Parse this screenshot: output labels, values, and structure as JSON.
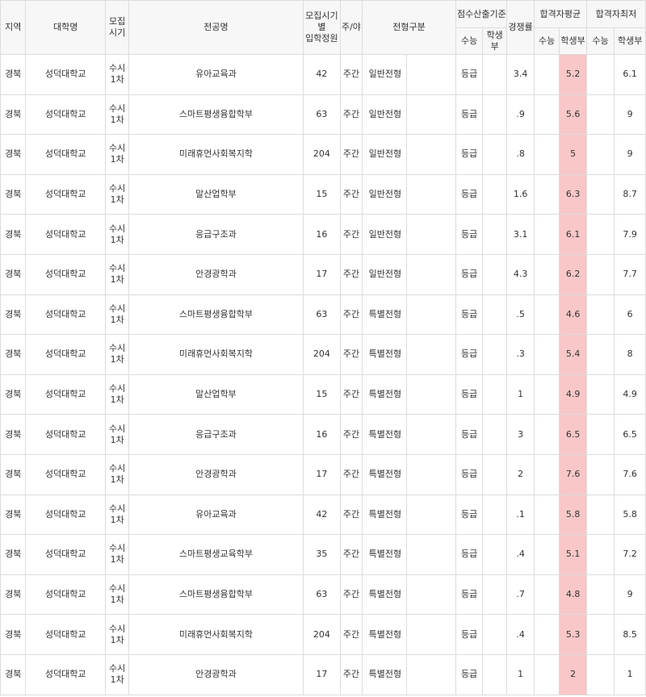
{
  "headers": {
    "region": "지역",
    "university": "대학명",
    "period": "모집\n시기",
    "major": "전공명",
    "quota": "모집시기별\n입학정원",
    "daynight": "주/야",
    "admission_type": "전형구분",
    "score_basis": "점수산출기준",
    "competition": "경쟁률",
    "avg": "합격자평균",
    "min": "합격자최저",
    "suneung": "수능",
    "school_record": "학생부"
  },
  "accent_color": "#f9c7c8",
  "rows": [
    {
      "region": "경북",
      "university": "성덕대학교",
      "period": "수시\n1차",
      "major": "유아교육과",
      "quota": "42",
      "daynight": "주간",
      "admission": "일반전형",
      "basis_suneung": "등급",
      "basis_record": "",
      "competition": "3.4",
      "avg_suneung": "",
      "avg_record": "5.2",
      "min_suneung": "",
      "min_record": "6.1"
    },
    {
      "region": "경북",
      "university": "성덕대학교",
      "period": "수시\n1차",
      "major": "스마트평생융합학부",
      "quota": "63",
      "daynight": "주간",
      "admission": "일반전형",
      "basis_suneung": "등급",
      "basis_record": "",
      "competition": ".9",
      "avg_suneung": "",
      "avg_record": "5.6",
      "min_suneung": "",
      "min_record": "9"
    },
    {
      "region": "경북",
      "university": "성덕대학교",
      "period": "수시\n1차",
      "major": "미래휴먼사회복지학",
      "quota": "204",
      "daynight": "주간",
      "admission": "일반전형",
      "basis_suneung": "등급",
      "basis_record": "",
      "competition": ".8",
      "avg_suneung": "",
      "avg_record": "5",
      "min_suneung": "",
      "min_record": "9"
    },
    {
      "region": "경북",
      "university": "성덕대학교",
      "period": "수시\n1차",
      "major": "말산업학부",
      "quota": "15",
      "daynight": "주간",
      "admission": "일반전형",
      "basis_suneung": "등급",
      "basis_record": "",
      "competition": "1.6",
      "avg_suneung": "",
      "avg_record": "6.3",
      "min_suneung": "",
      "min_record": "8.7"
    },
    {
      "region": "경북",
      "university": "성덕대학교",
      "period": "수시\n1차",
      "major": "응급구조과",
      "quota": "16",
      "daynight": "주간",
      "admission": "일반전형",
      "basis_suneung": "등급",
      "basis_record": "",
      "competition": "3.1",
      "avg_suneung": "",
      "avg_record": "6.1",
      "min_suneung": "",
      "min_record": "7.9"
    },
    {
      "region": "경북",
      "university": "성덕대학교",
      "period": "수시\n1차",
      "major": "안경광학과",
      "quota": "17",
      "daynight": "주간",
      "admission": "일반전형",
      "basis_suneung": "등급",
      "basis_record": "",
      "competition": "4.3",
      "avg_suneung": "",
      "avg_record": "6.2",
      "min_suneung": "",
      "min_record": "7.7"
    },
    {
      "region": "경북",
      "university": "성덕대학교",
      "period": "수시\n1차",
      "major": "스마트평생융합학부",
      "quota": "63",
      "daynight": "주간",
      "admission": "특별전형",
      "basis_suneung": "등급",
      "basis_record": "",
      "competition": ".5",
      "avg_suneung": "",
      "avg_record": "4.6",
      "min_suneung": "",
      "min_record": "6"
    },
    {
      "region": "경북",
      "university": "성덕대학교",
      "period": "수시\n1차",
      "major": "미래휴먼사회복지학",
      "quota": "204",
      "daynight": "주간",
      "admission": "특별전형",
      "basis_suneung": "등급",
      "basis_record": "",
      "competition": ".3",
      "avg_suneung": "",
      "avg_record": "5.4",
      "min_suneung": "",
      "min_record": "8"
    },
    {
      "region": "경북",
      "university": "성덕대학교",
      "period": "수시\n1차",
      "major": "말산업학부",
      "quota": "15",
      "daynight": "주간",
      "admission": "특별전형",
      "basis_suneung": "등급",
      "basis_record": "",
      "competition": "1",
      "avg_suneung": "",
      "avg_record": "4.9",
      "min_suneung": "",
      "min_record": "4.9"
    },
    {
      "region": "경북",
      "university": "성덕대학교",
      "period": "수시\n1차",
      "major": "응급구조과",
      "quota": "16",
      "daynight": "주간",
      "admission": "특별전형",
      "basis_suneung": "등급",
      "basis_record": "",
      "competition": "3",
      "avg_suneung": "",
      "avg_record": "6.5",
      "min_suneung": "",
      "min_record": "6.5"
    },
    {
      "region": "경북",
      "university": "성덕대학교",
      "period": "수시\n1차",
      "major": "안경광학과",
      "quota": "17",
      "daynight": "주간",
      "admission": "특별전형",
      "basis_suneung": "등급",
      "basis_record": "",
      "competition": "2",
      "avg_suneung": "",
      "avg_record": "7.6",
      "min_suneung": "",
      "min_record": "7.6"
    },
    {
      "region": "경북",
      "university": "성덕대학교",
      "period": "수시\n1차",
      "major": "유아교육과",
      "quota": "42",
      "daynight": "주간",
      "admission": "특별전형",
      "basis_suneung": "등급",
      "basis_record": "",
      "competition": ".1",
      "avg_suneung": "",
      "avg_record": "5.8",
      "min_suneung": "",
      "min_record": "5.8"
    },
    {
      "region": "경북",
      "university": "성덕대학교",
      "period": "수시\n1차",
      "major": "스마트평생교육학부",
      "quota": "35",
      "daynight": "주간",
      "admission": "특별전형",
      "basis_suneung": "등급",
      "basis_record": "",
      "competition": ".4",
      "avg_suneung": "",
      "avg_record": "5.1",
      "min_suneung": "",
      "min_record": "7.2"
    },
    {
      "region": "경북",
      "university": "성덕대학교",
      "period": "수시\n1차",
      "major": "스마트평생융합학부",
      "quota": "63",
      "daynight": "주간",
      "admission": "특별전형",
      "basis_suneung": "등급",
      "basis_record": "",
      "competition": ".7",
      "avg_suneung": "",
      "avg_record": "4.8",
      "min_suneung": "",
      "min_record": "9"
    },
    {
      "region": "경북",
      "university": "성덕대학교",
      "period": "수시\n1차",
      "major": "미래휴먼사회복지학",
      "quota": "204",
      "daynight": "주간",
      "admission": "특별전형",
      "basis_suneung": "등급",
      "basis_record": "",
      "competition": ".4",
      "avg_suneung": "",
      "avg_record": "5.3",
      "min_suneung": "",
      "min_record": "8.5"
    },
    {
      "region": "경북",
      "university": "성덕대학교",
      "period": "수시\n1차",
      "major": "안경광학과",
      "quota": "17",
      "daynight": "주간",
      "admission": "특별전형",
      "basis_suneung": "등급",
      "basis_record": "",
      "competition": "1",
      "avg_suneung": "",
      "avg_record": "2",
      "min_suneung": "",
      "min_record": "1"
    }
  ]
}
